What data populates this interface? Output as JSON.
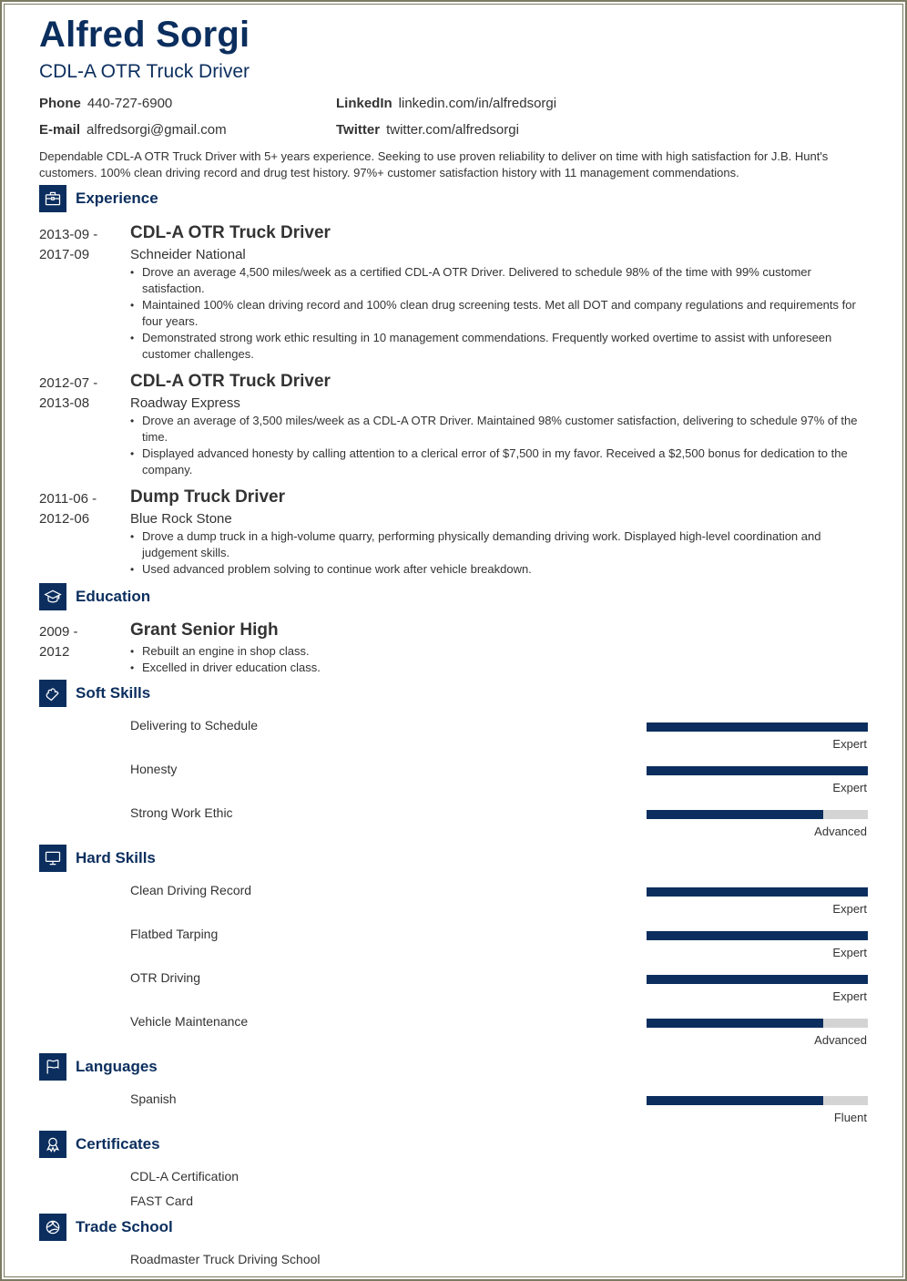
{
  "header": {
    "name": "Alfred Sorgi",
    "title": "CDL-A OTR Truck Driver"
  },
  "contact": {
    "phone_label": "Phone",
    "phone": "440-727-6900",
    "email_label": "E-mail",
    "email": "alfredsorgi@gmail.com",
    "linkedin_label": "LinkedIn",
    "linkedin": "linkedin.com/in/alfredsorgi",
    "twitter_label": "Twitter",
    "twitter": "twitter.com/alfredsorgi"
  },
  "summary": "Dependable CDL-A OTR Truck Driver with 5+ years experience. Seeking to use proven reliability to deliver on time with high satisfaction for J.B. Hunt's customers. 100% clean driving record and drug test history. 97%+ customer satisfaction history with 11 management commendations.",
  "colors": {
    "accent": "#0b2e5e",
    "bar_empty": "#d4d4d4",
    "text": "#333333",
    "frame": "#7a7a62"
  },
  "sections": {
    "experience": {
      "title": "Experience",
      "icon": "briefcase-icon"
    },
    "education": {
      "title": "Education",
      "icon": "graduation-cap-icon"
    },
    "soft_skills": {
      "title": "Soft Skills",
      "icon": "puzzle-icon"
    },
    "hard_skills": {
      "title": "Hard Skills",
      "icon": "monitor-icon"
    },
    "languages": {
      "title": "Languages",
      "icon": "flag-icon"
    },
    "certificates": {
      "title": "Certificates",
      "icon": "award-ribbon-icon"
    },
    "trade_school": {
      "title": "Trade School",
      "icon": "basketball-icon"
    }
  },
  "experience": [
    {
      "date_start": "2013-09 -",
      "date_end": "2017-09",
      "title": "CDL-A OTR Truck Driver",
      "company": "Schneider National",
      "bullets": [
        "Drove an average 4,500 miles/week as a certified CDL-A OTR Driver. Delivered to schedule 98% of the time with 99% customer satisfaction.",
        "Maintained 100% clean driving record and 100% clean drug screening tests. Met all DOT and company regulations and requirements for four years.",
        "Demonstrated strong work ethic resulting in 10 management commendations. Frequently worked overtime to assist with unforeseen customer challenges."
      ]
    },
    {
      "date_start": "2012-07 -",
      "date_end": "2013-08",
      "title": "CDL-A OTR Truck Driver",
      "company": "Roadway Express",
      "bullets": [
        "Drove an average of 3,500 miles/week as a CDL-A OTR Driver. Maintained 98% customer satisfaction, delivering to schedule 97% of the time.",
        "Displayed advanced honesty by calling attention to a clerical error of $7,500 in my favor. Received a $2,500 bonus for dedication to the company."
      ]
    },
    {
      "date_start": "2011-06 -",
      "date_end": "2012-06",
      "title": "Dump Truck Driver",
      "company": "Blue Rock Stone",
      "bullets": [
        "Drove a dump truck in a high-volume quarry, performing physically demanding driving work. Displayed high-level coordination and judgement skills.",
        "Used advanced problem solving to continue work after vehicle breakdown."
      ]
    }
  ],
  "education": [
    {
      "date_start": "2009 -",
      "date_end": "2012",
      "school": "Grant Senior High",
      "bullets": [
        "Rebuilt an engine in shop class.",
        "Excelled in driver education class."
      ]
    }
  ],
  "soft_skills": [
    {
      "name": "Delivering to Schedule",
      "level": "Expert",
      "rating": 5,
      "max": 5
    },
    {
      "name": "Honesty",
      "level": "Expert",
      "rating": 5,
      "max": 5
    },
    {
      "name": "Strong Work Ethic",
      "level": "Advanced",
      "rating": 4,
      "max": 5
    }
  ],
  "hard_skills": [
    {
      "name": "Clean Driving Record",
      "level": "Expert",
      "rating": 5,
      "max": 5
    },
    {
      "name": "Flatbed Tarping",
      "level": "Expert",
      "rating": 5,
      "max": 5
    },
    {
      "name": "OTR Driving",
      "level": "Expert",
      "rating": 5,
      "max": 5
    },
    {
      "name": "Vehicle Maintenance",
      "level": "Advanced",
      "rating": 4,
      "max": 5
    }
  ],
  "languages": [
    {
      "name": "Spanish",
      "level": "Fluent",
      "rating": 4,
      "max": 5
    }
  ],
  "certificates": [
    "CDL-A Certification",
    "FAST Card"
  ],
  "trade_school": [
    "Roadmaster Truck Driving School"
  ]
}
